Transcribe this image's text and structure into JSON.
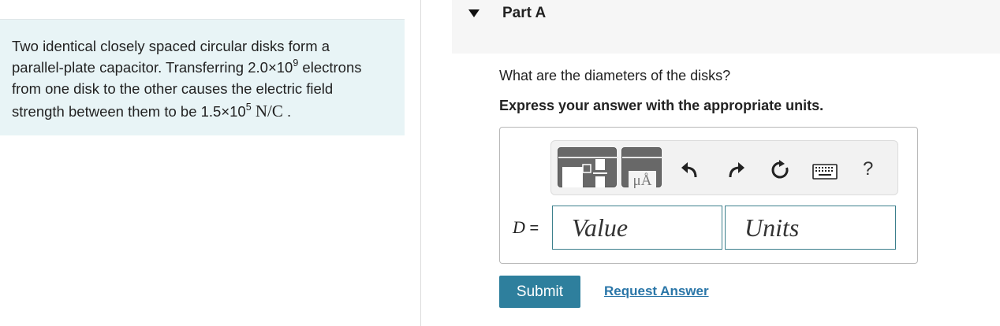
{
  "problem": {
    "line1": "Two identical closely spaced circular disks form a",
    "line2_pre": "parallel-plate capacitor. Transferring 2.0×10",
    "line2_exp": "9",
    "line2_post": " electrons",
    "line3": "from one disk to the other causes the electric field",
    "line4_pre": "strength between them to be 1.5×10",
    "line4_exp": "5",
    "line4_unit": "N/C",
    "line4_end": " ."
  },
  "part": {
    "title": "Part A",
    "question": "What are the diameters of the disks?",
    "instruction": "Express your answer with the appropriate units."
  },
  "toolbar": {
    "units_symbol": "μÅ",
    "help": "?"
  },
  "answer": {
    "variable": "D",
    "equals": " =",
    "value_placeholder": "Value",
    "units_placeholder": "Units"
  },
  "actions": {
    "submit_label": "Submit",
    "request_label": "Request Answer"
  },
  "colors": {
    "problem_bg": "#e8f4f6",
    "submit_bg": "#2e7f9d",
    "link": "#2a76a8",
    "field_border": "#3c7f8c"
  }
}
